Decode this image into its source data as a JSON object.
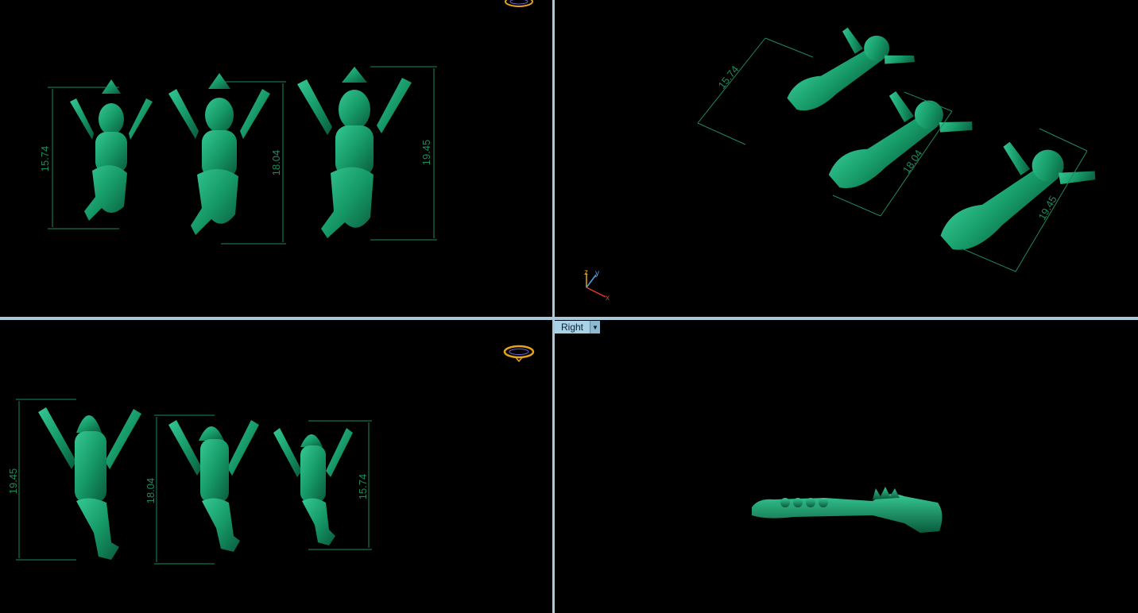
{
  "viewports": {
    "perspective_label": "Right",
    "dimensions": [
      "15.74",
      "18.04",
      "19.45"
    ]
  },
  "axes": {
    "x": "x",
    "y": "y",
    "z": "z"
  },
  "colors": {
    "background": "#000000",
    "model": "#1a9a6a",
    "dimension_line": "#1d8a5c",
    "divider": "#a9c9d9",
    "label_bg": "#a9d2e6",
    "gumball": "#e3a21a"
  },
  "icons": [
    "gumball-icon",
    "axis-triad-icon",
    "dropdown-arrow-icon"
  ]
}
